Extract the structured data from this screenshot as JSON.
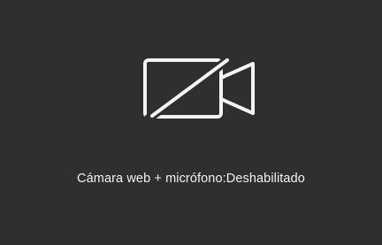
{
  "panel": {
    "background_color": "#2f2f2f",
    "icon": "video-camera-off-icon",
    "status_label": "Cámara web + micrófono:Deshabilitado",
    "text_color": "#f2f2f2"
  }
}
